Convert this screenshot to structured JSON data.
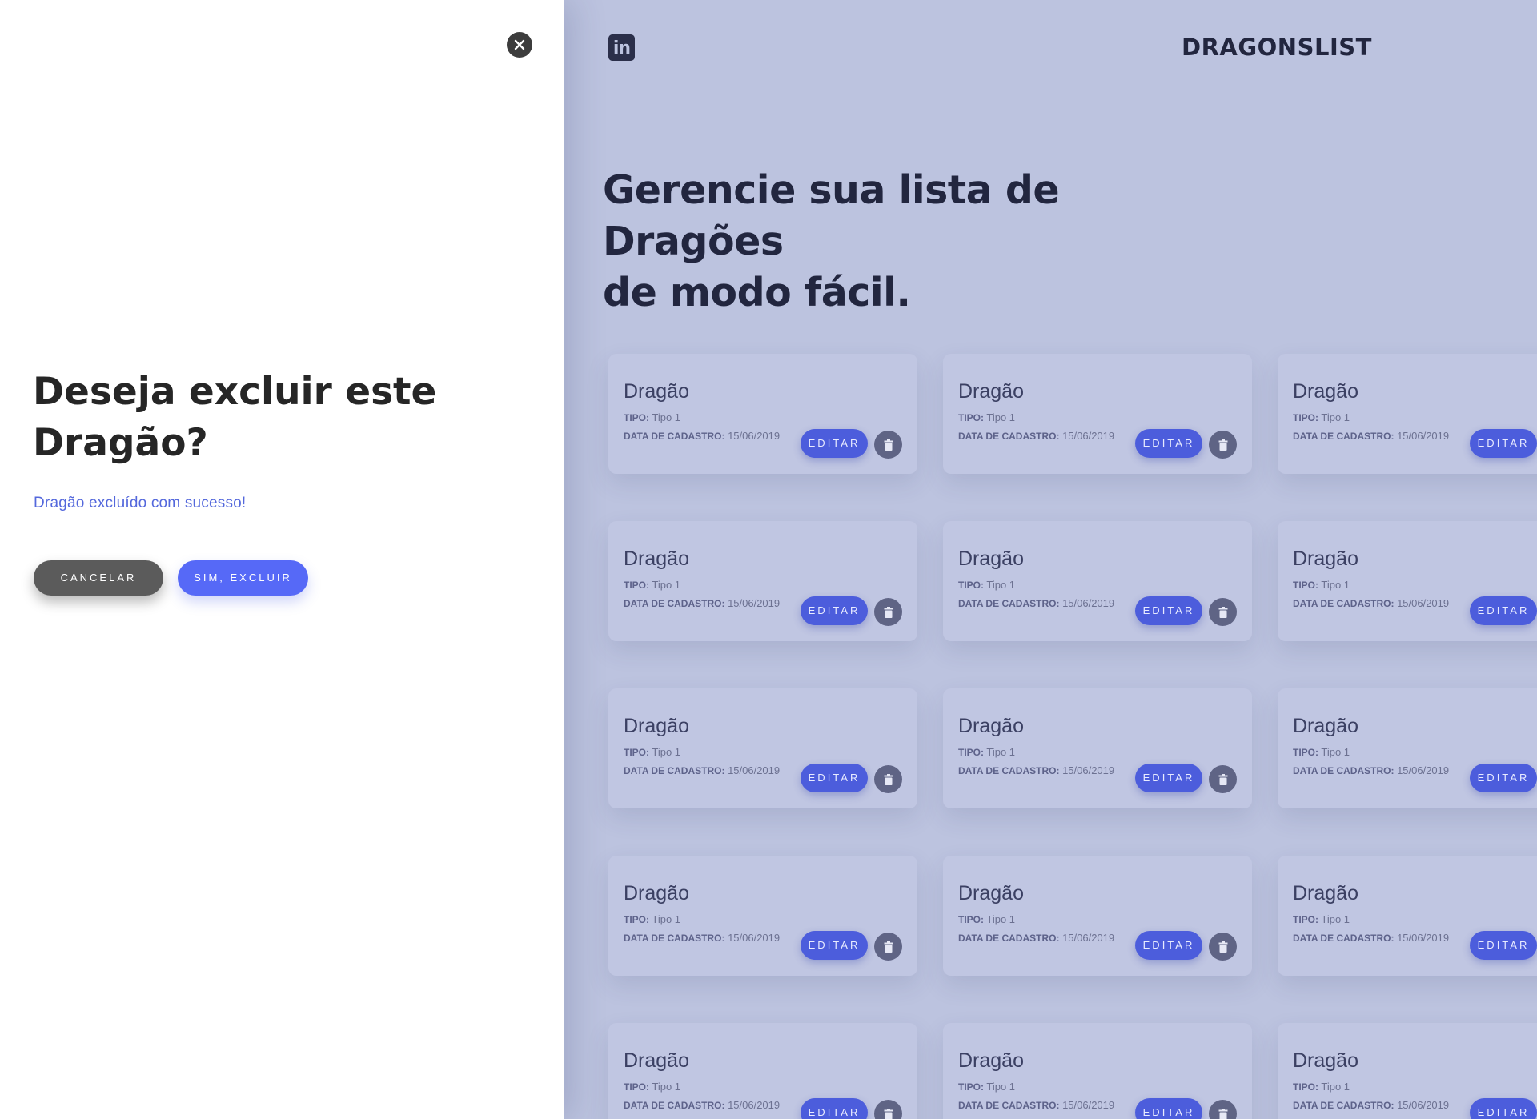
{
  "header": {
    "linkedin_icon": "linkedin-icon",
    "linkedin_label": "in",
    "brand": "DRAGONSLIST"
  },
  "hero": {
    "line1": "Gerencie sua lista de Dragões",
    "line2": "de modo fácil."
  },
  "dragons": [
    {
      "name": "Dragão",
      "type_label": "TIPO:",
      "type": "Tipo 1",
      "date_label": "DATA DE CADASTRO:",
      "date": "15/06/2019",
      "edit_label": "EDITAR"
    },
    {
      "name": "Dragão",
      "type_label": "TIPO:",
      "type": "Tipo 1",
      "date_label": "DATA DE CADASTRO:",
      "date": "15/06/2019",
      "edit_label": "EDITAR"
    },
    {
      "name": "Dragão",
      "type_label": "TIPO:",
      "type": "Tipo 1",
      "date_label": "DATA DE CADASTRO:",
      "date": "15/06/2019",
      "edit_label": "EDITAR"
    },
    {
      "name": "Dragão",
      "type_label": "TIPO:",
      "type": "Tipo 1",
      "date_label": "DATA DE CADASTRO:",
      "date": "15/06/2019",
      "edit_label": "EDITAR"
    },
    {
      "name": "Dragão",
      "type_label": "TIPO:",
      "type": "Tipo 1",
      "date_label": "DATA DE CADASTRO:",
      "date": "15/06/2019",
      "edit_label": "EDITAR"
    },
    {
      "name": "Dragão",
      "type_label": "TIPO:",
      "type": "Tipo 1",
      "date_label": "DATA DE CADASTRO:",
      "date": "15/06/2019",
      "edit_label": "EDITAR"
    },
    {
      "name": "Dragão",
      "type_label": "TIPO:",
      "type": "Tipo 1",
      "date_label": "DATA DE CADASTRO:",
      "date": "15/06/2019",
      "edit_label": "EDITAR"
    },
    {
      "name": "Dragão",
      "type_label": "TIPO:",
      "type": "Tipo 1",
      "date_label": "DATA DE CADASTRO:",
      "date": "15/06/2019",
      "edit_label": "EDITAR"
    },
    {
      "name": "Dragão",
      "type_label": "TIPO:",
      "type": "Tipo 1",
      "date_label": "DATA DE CADASTRO:",
      "date": "15/06/2019",
      "edit_label": "EDITAR"
    },
    {
      "name": "Dragão",
      "type_label": "TIPO:",
      "type": "Tipo 1",
      "date_label": "DATA DE CADASTRO:",
      "date": "15/06/2019",
      "edit_label": "EDITAR"
    },
    {
      "name": "Dragão",
      "type_label": "TIPO:",
      "type": "Tipo 1",
      "date_label": "DATA DE CADASTRO:",
      "date": "15/06/2019",
      "edit_label": "EDITAR"
    },
    {
      "name": "Dragão",
      "type_label": "TIPO:",
      "type": "Tipo 1",
      "date_label": "DATA DE CADASTRO:",
      "date": "15/06/2019",
      "edit_label": "EDITAR"
    },
    {
      "name": "Dragão",
      "type_label": "TIPO:",
      "type": "Tipo 1",
      "date_label": "DATA DE CADASTRO:",
      "date": "15/06/2019",
      "edit_label": "EDITAR"
    },
    {
      "name": "Dragão",
      "type_label": "TIPO:",
      "type": "Tipo 1",
      "date_label": "DATA DE CADASTRO:",
      "date": "15/06/2019",
      "edit_label": "EDITAR"
    },
    {
      "name": "Dragão",
      "type_label": "TIPO:",
      "type": "Tipo 1",
      "date_label": "DATA DE CADASTRO:",
      "date": "15/06/2019",
      "edit_label": "EDITAR"
    }
  ],
  "modal": {
    "close_icon": "close-icon",
    "title_line1": "Deseja excluir este",
    "title_line2": "Dragão?",
    "message": "Dragão excluído com sucesso!",
    "cancel_label": "CANCELAR",
    "confirm_label": "SIM, EXCLUIR"
  },
  "colors": {
    "accent": "#5669f7",
    "success_text": "#5468dc",
    "cancel_button": "#5b5b5b",
    "overlay_bg": "#bcc3df",
    "dark_text": "#22263f"
  }
}
